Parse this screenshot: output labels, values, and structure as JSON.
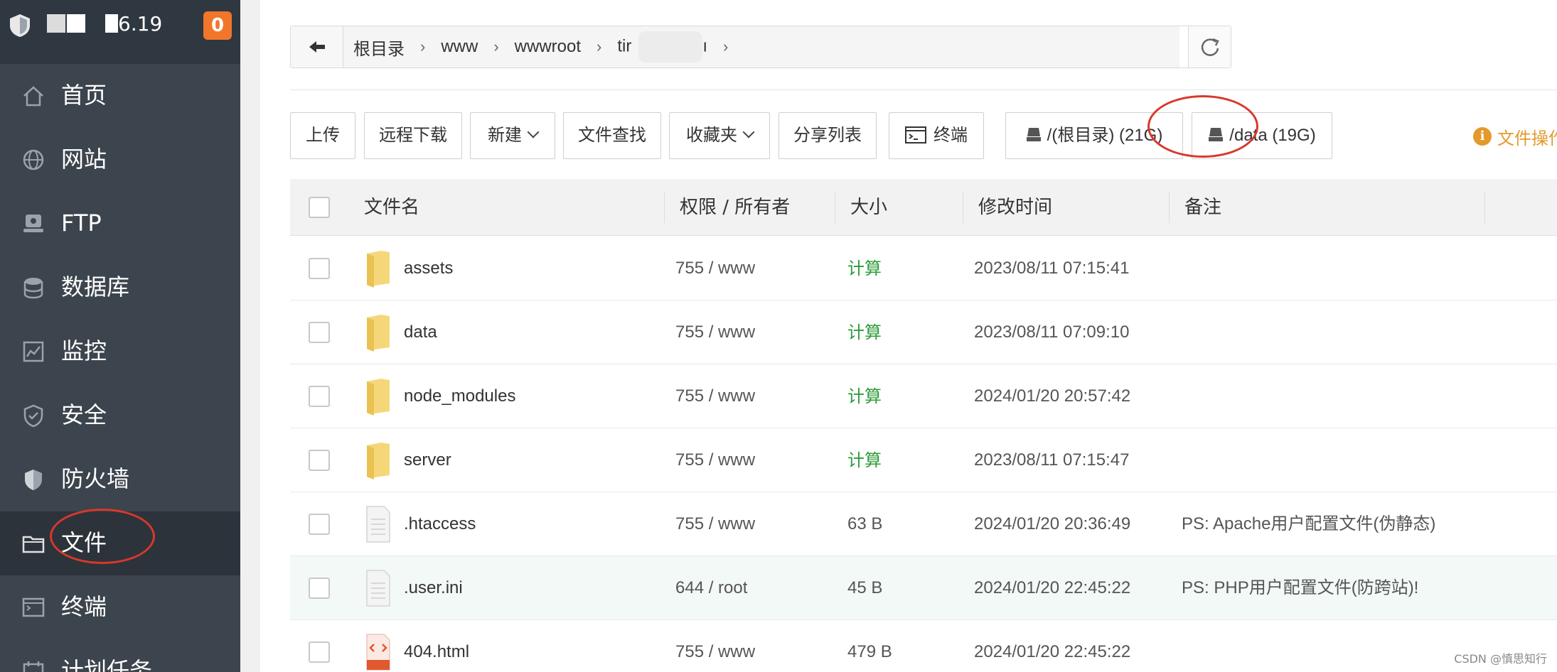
{
  "sidebar": {
    "ip_suffix": "6.19",
    "badge_count": "0",
    "items": [
      {
        "label": "首页",
        "icon": "home-icon"
      },
      {
        "label": "网站",
        "icon": "globe-icon"
      },
      {
        "label": "FTP",
        "icon": "ftp-icon"
      },
      {
        "label": "数据库",
        "icon": "database-icon"
      },
      {
        "label": "监控",
        "icon": "monitor-icon"
      },
      {
        "label": "安全",
        "icon": "shield-icon"
      },
      {
        "label": "防火墙",
        "icon": "firewall-icon"
      },
      {
        "label": "文件",
        "icon": "folder-icon",
        "active": true
      },
      {
        "label": "终端",
        "icon": "terminal-icon"
      },
      {
        "label": "计划任务",
        "icon": "calendar-icon"
      }
    ]
  },
  "breadcrumb": {
    "items": [
      "根目录",
      "www",
      "wwwroot",
      "tir",
      "ı"
    ]
  },
  "toolbar": {
    "upload": "上传",
    "remote_download": "远程下载",
    "new": "新建",
    "search_files": "文件查找",
    "favorites": "收藏夹",
    "share_list": "分享列表",
    "terminal": "终端",
    "disk_root": "/(根目录) (21G)",
    "disk_data": "/data (19G)",
    "file_ops": "文件操作"
  },
  "table": {
    "headers": {
      "name": "文件名",
      "perm": "权限 / 所有者",
      "size": "大小",
      "mtime": "修改时间",
      "note": "备注"
    },
    "rows": [
      {
        "name": "assets",
        "type": "folder",
        "perm": "755 / www",
        "size": "计算",
        "mtime": "2023/08/11 07:15:41",
        "note": ""
      },
      {
        "name": "data",
        "type": "folder",
        "perm": "755 / www",
        "size": "计算",
        "mtime": "2023/08/11 07:09:10",
        "note": ""
      },
      {
        "name": "node_modules",
        "type": "folder",
        "perm": "755 / www",
        "size": "计算",
        "mtime": "2024/01/20 20:57:42",
        "note": ""
      },
      {
        "name": "server",
        "type": "folder",
        "perm": "755 / www",
        "size": "计算",
        "mtime": "2023/08/11 07:15:47",
        "note": ""
      },
      {
        "name": ".htaccess",
        "type": "file",
        "perm": "755 / www",
        "size": "63 B",
        "mtime": "2024/01/20 20:36:49",
        "note": "PS: Apache用户配置文件(伪静态)"
      },
      {
        "name": ".user.ini",
        "type": "file",
        "perm": "644 / root",
        "size": "45 B",
        "mtime": "2024/01/20 22:45:22",
        "note": "PS: PHP用户配置文件(防跨站)!"
      },
      {
        "name": "404.html",
        "type": "html",
        "perm": "755 / www",
        "size": "479 B",
        "mtime": "2024/01/20 22:45:22",
        "note": ""
      }
    ]
  },
  "watermark": "CSDN @慎思知行",
  "colors": {
    "sidebar_bg": "#3c444d",
    "accent_green": "#2e9d3a",
    "badge_orange": "#f0762a",
    "annotation_red": "#d8382b",
    "folder_yellow": "#f5d77a"
  }
}
